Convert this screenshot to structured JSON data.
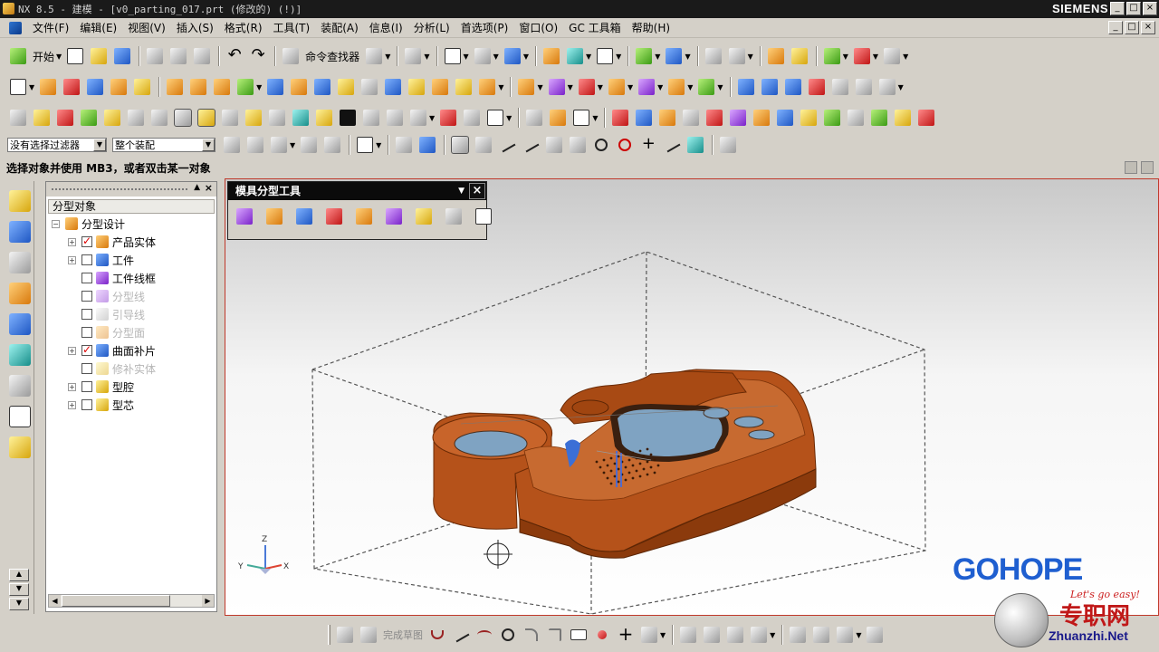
{
  "window": {
    "title": "NX 8.5 - 建模 - [v0_parting_017.prt (修改的)      (!)]",
    "brand": "SIEMENS",
    "controls": [
      "_",
      "□",
      "×"
    ]
  },
  "menu": {
    "items": [
      "文件(F)",
      "编辑(E)",
      "视图(V)",
      "插入(S)",
      "格式(R)",
      "工具(T)",
      "装配(A)",
      "信息(I)",
      "分析(L)",
      "首选项(P)",
      "窗口(O)",
      "GC 工具箱",
      "帮助(H)"
    ]
  },
  "toolbar1": {
    "start_label": "开始",
    "command_finder_label": "命令查找器"
  },
  "filter": {
    "type_filter": "没有选择过滤器",
    "scope_filter": "整个装配"
  },
  "cue": {
    "text": "选择对象并使用 MB3，或者双击某一对象"
  },
  "navigator": {
    "column_header": "分型对象",
    "root": "分型设计",
    "items": [
      {
        "label": "产品实体",
        "checked": true,
        "expandable": true,
        "dim": false
      },
      {
        "label": "工件",
        "checked": false,
        "expandable": true,
        "dim": false
      },
      {
        "label": "工件线框",
        "checked": false,
        "expandable": false,
        "dim": false
      },
      {
        "label": "分型线",
        "checked": false,
        "expandable": false,
        "dim": true
      },
      {
        "label": "引导线",
        "checked": false,
        "expandable": false,
        "dim": true
      },
      {
        "label": "分型面",
        "checked": false,
        "expandable": false,
        "dim": true
      },
      {
        "label": "曲面补片",
        "checked": true,
        "expandable": true,
        "dim": false
      },
      {
        "label": "修补实体",
        "checked": false,
        "expandable": false,
        "dim": true
      },
      {
        "label": "型腔",
        "checked": false,
        "expandable": true,
        "dim": false
      },
      {
        "label": "型芯",
        "checked": false,
        "expandable": true,
        "dim": false
      }
    ]
  },
  "mold_toolbar": {
    "title": "模具分型工具",
    "close": "×"
  },
  "triad": {
    "x": "X",
    "y": "Y",
    "z": "Z"
  },
  "bottombar": {
    "finish_sketch_label": "完成草图"
  },
  "watermark": {
    "brand": "GOHOPE",
    "slogan": "Let's go easy!",
    "cn": "专职网",
    "url": "Zhuanzhi.Net"
  },
  "colors": {
    "part": "#b5521a",
    "part_dark": "#7a3208",
    "window_blue": "#7fa3c2",
    "viewport_border": "#c0392b",
    "watermark_blue": "#1f5fd0"
  }
}
